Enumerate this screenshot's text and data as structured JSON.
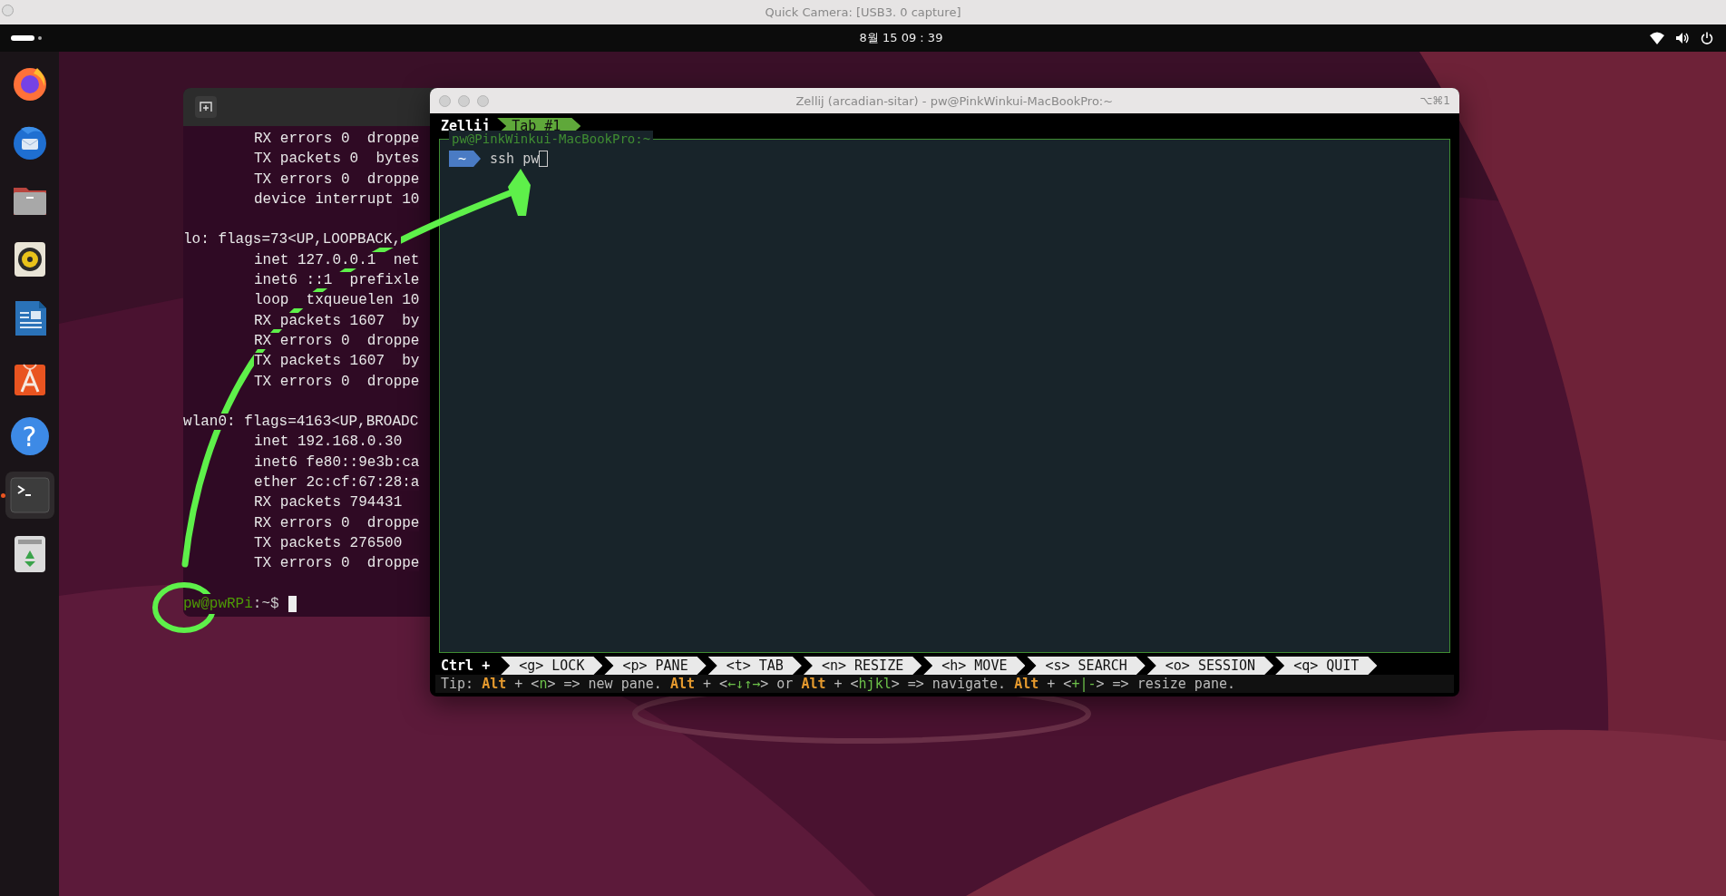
{
  "camera_window": {
    "title": "Quick Camera: [USB3. 0 capture]"
  },
  "top_bar": {
    "clock": "8월 15 09 : 39"
  },
  "dock": [
    {
      "kind": "firefox",
      "running": false
    },
    {
      "kind": "thunderbird",
      "running": false
    },
    {
      "kind": "files",
      "running": false
    },
    {
      "kind": "rhythmbox",
      "running": false
    },
    {
      "kind": "writer",
      "running": false
    },
    {
      "kind": "appcenter",
      "running": false
    },
    {
      "kind": "help",
      "glyph": "?",
      "running": false
    },
    {
      "kind": "terminal",
      "running": true
    },
    {
      "kind": "trash",
      "running": false
    }
  ],
  "back_terminal": {
    "lines": [
      {
        "kind": "detail",
        "text": "RX errors 0  droppe"
      },
      {
        "kind": "detail",
        "text": "TX packets 0  bytes"
      },
      {
        "kind": "detail",
        "text": "TX errors 0  droppe"
      },
      {
        "kind": "detail",
        "text": "device interrupt 10"
      },
      {
        "kind": "blank"
      },
      {
        "kind": "header",
        "text": "lo: flags=73<UP,LOOPBACK,"
      },
      {
        "kind": "detail",
        "text": "inet 127.0.0.1  net"
      },
      {
        "kind": "detail",
        "text": "inet6 ::1  prefixle"
      },
      {
        "kind": "detail",
        "text": "loop  txqueuelen 10"
      },
      {
        "kind": "detail",
        "text": "RX packets 1607  by"
      },
      {
        "kind": "detail",
        "text": "RX errors 0  droppe"
      },
      {
        "kind": "detail",
        "text": "TX packets 1607  by"
      },
      {
        "kind": "detail",
        "text": "TX errors 0  droppe"
      },
      {
        "kind": "blank"
      },
      {
        "kind": "header",
        "text": "wlan0: flags=4163<UP,BROADC"
      },
      {
        "kind": "detail",
        "text": "inet 192.168.0.30"
      },
      {
        "kind": "detail",
        "text": "inet6 fe80::9e3b:ca"
      },
      {
        "kind": "detail",
        "text": "ether 2c:cf:67:28:a"
      },
      {
        "kind": "detail",
        "text": "RX packets 794431"
      },
      {
        "kind": "detail",
        "text": "RX errors 0  droppe"
      },
      {
        "kind": "detail",
        "text": "TX packets 276500"
      },
      {
        "kind": "detail",
        "text": "TX errors 0  droppe"
      },
      {
        "kind": "blank"
      }
    ],
    "prompt": {
      "user_host": "pw@pwRPi",
      "path": ":~$"
    }
  },
  "zellij_window": {
    "title": "Zellij (arcadian-sitar) - pw@PinkWinkui-MacBookPro:~",
    "shortcut": "⌥⌘1",
    "session_label": "Zellij",
    "tabs": [
      {
        "label": "Tab #1",
        "selected": true
      }
    ],
    "pane": {
      "title": "pw@PinkWinkui-MacBookPro:~",
      "prompt_dir": "~",
      "command": "ssh pw"
    },
    "keybar": {
      "modifier": "Ctrl +",
      "items": [
        {
          "key": "<g>",
          "action": "LOCK"
        },
        {
          "key": "<p>",
          "action": "PANE"
        },
        {
          "key": "<t>",
          "action": "TAB"
        },
        {
          "key": "<n>",
          "action": "RESIZE"
        },
        {
          "key": "<h>",
          "action": "MOVE"
        },
        {
          "key": "<s>",
          "action": "SEARCH"
        },
        {
          "key": "<o>",
          "action": "SESSION"
        },
        {
          "key": "<q>",
          "action": "QUIT"
        }
      ]
    },
    "tip": [
      {
        "kind": "plain",
        "text": "Tip: "
      },
      {
        "kind": "mod",
        "text": "Alt"
      },
      {
        "kind": "plain",
        "text": " + <"
      },
      {
        "kind": "key",
        "text": "n"
      },
      {
        "kind": "plain",
        "text": "> => new pane. "
      },
      {
        "kind": "mod",
        "text": "Alt"
      },
      {
        "kind": "plain",
        "text": " + <"
      },
      {
        "kind": "key",
        "text": "←↓↑→"
      },
      {
        "kind": "plain",
        "text": "> or "
      },
      {
        "kind": "mod",
        "text": "Alt"
      },
      {
        "kind": "plain",
        "text": " + <"
      },
      {
        "kind": "key",
        "text": "hjkl"
      },
      {
        "kind": "plain",
        "text": "> => navigate. "
      },
      {
        "kind": "mod",
        "text": "Alt"
      },
      {
        "kind": "plain",
        "text": " + <"
      },
      {
        "kind": "key",
        "text": "+|-"
      },
      {
        "kind": "plain",
        "text": "> => resize pane."
      }
    ]
  }
}
